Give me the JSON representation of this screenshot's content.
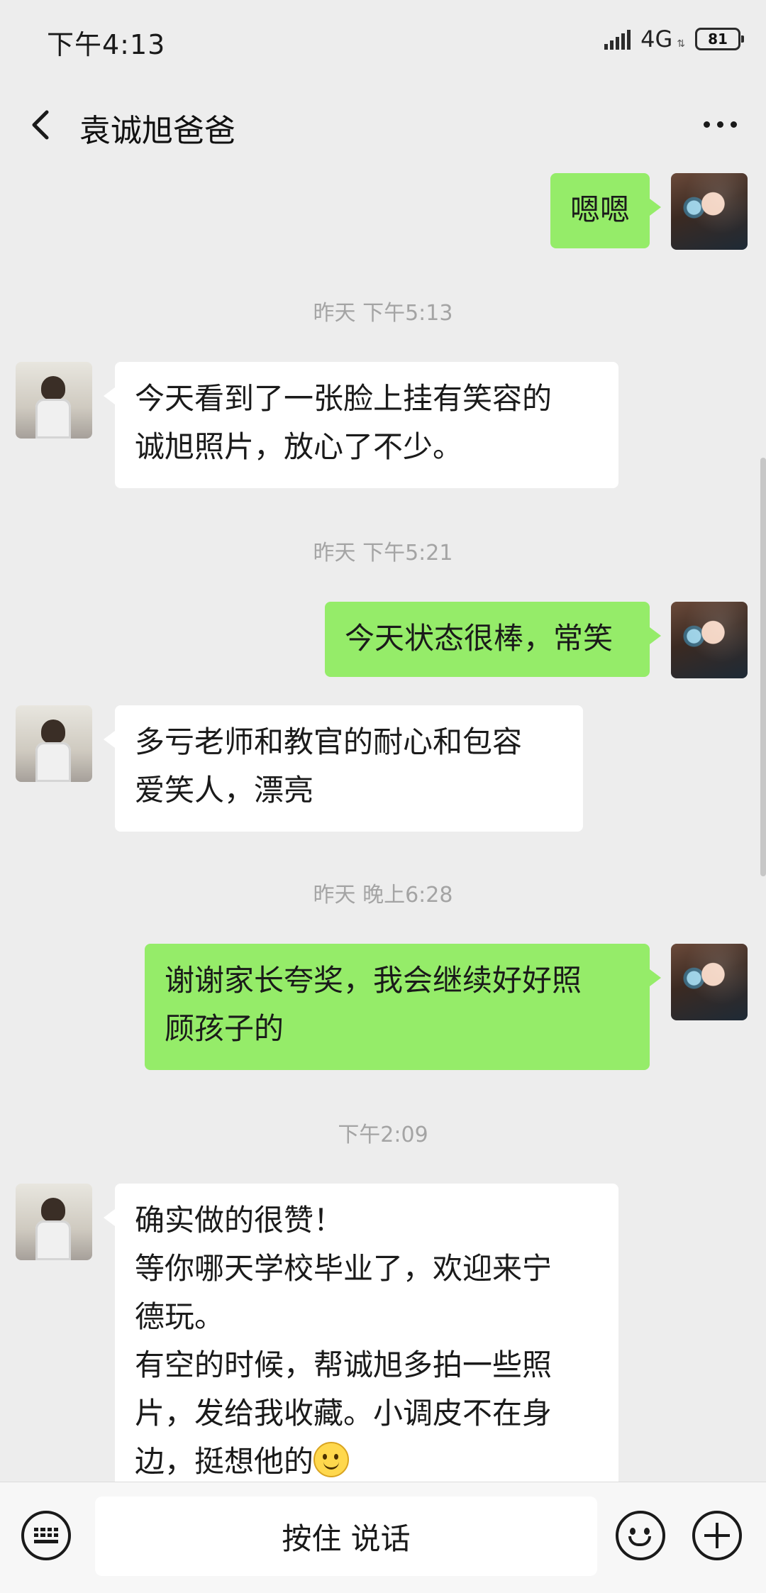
{
  "status_bar": {
    "time": "下午4:13",
    "network": "4G",
    "battery": "81"
  },
  "nav": {
    "title": "袁诚旭爸爸"
  },
  "messages": [
    {
      "type": "out",
      "text": "嗯嗯"
    },
    {
      "type": "time",
      "text": "昨天 下午5:13"
    },
    {
      "type": "in",
      "text": "今天看到了一张脸上挂有笑容的\n诚旭照片，放心了不少。"
    },
    {
      "type": "time",
      "text": "昨天 下午5:21"
    },
    {
      "type": "out",
      "text": "今天状态很棒，常笑"
    },
    {
      "type": "in",
      "text": "多亏老师和教官的耐心和包容\n爱笑人，漂亮"
    },
    {
      "type": "time",
      "text": "昨天 晚上6:28"
    },
    {
      "type": "out",
      "text": "谢谢家长夸奖，我会继续好好照\n顾孩子的"
    },
    {
      "type": "time",
      "text": "下午2:09"
    },
    {
      "type": "in",
      "text": "确实做的很赞！\n等你哪天学校毕业了，欢迎来宁\n德玩。\n有空的时候，帮诚旭多拍一些照\n片，发给我收藏。小调皮不在身\n边，挺想他的",
      "emoji": "smile-emoji"
    }
  ],
  "input_bar": {
    "hold_to_talk": "按住 说话"
  }
}
